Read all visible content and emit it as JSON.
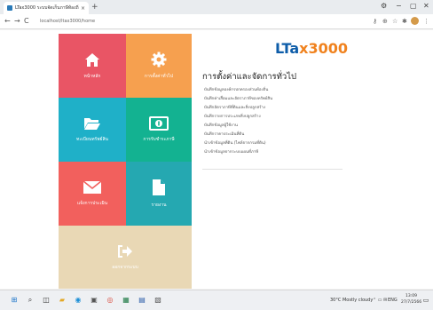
{
  "browser": {
    "tab_title": "LTax3000 ระบบจัดเก็บภาษีท้องถิ่น",
    "tab_close": "×",
    "new_tab": "+",
    "url": "localhost/ltax3000/home",
    "back": "←",
    "forward": "→",
    "reload": "C",
    "home": "⌂"
  },
  "window_controls": {
    "settings": "⚙",
    "minimize": "−",
    "maximize": "▢",
    "close": "✕"
  },
  "tiles": [
    {
      "id": "home",
      "label": "หน้าหลัก",
      "color": "#e95565",
      "icon": "home-icon"
    },
    {
      "id": "settings",
      "label": "การตั้งค่าทั่วไป",
      "color": "#f6a04f",
      "icon": "gear-icon"
    },
    {
      "id": "register",
      "label": "ทะเบียนทรัพย์สิน",
      "color": "#1fb0c8",
      "icon": "folder-icon"
    },
    {
      "id": "payment",
      "label": "การรับชำระภาษี",
      "color": "#13b291",
      "icon": "money-icon"
    },
    {
      "id": "notice",
      "label": "แจ้งการประเมิน",
      "color": "#f2605d",
      "icon": "envelope-icon"
    },
    {
      "id": "report",
      "label": "รายงาน",
      "color": "#25a8b1",
      "icon": "document-icon"
    },
    {
      "id": "logout",
      "label": "ออกจากระบบ",
      "color": "#e9d8b5",
      "icon": "logout-icon"
    }
  ],
  "logo": {
    "part1": "LTa",
    "part2": "x3000"
  },
  "content": {
    "heading": "การตั้งค่าและจัดการทั่วไป",
    "items": [
      "บันทึกข้อมูลองค์กรปกครองส่วนท้องถิ่น",
      "บันทึกค่าเสื่อมและอัตราภาษีของทรัพย์สิน",
      "บันทึกอัตราภาษีที่ดินและสิ่งปลูกสร้าง",
      "บันทึกรายการประเภทสิ่งปลูกสร้าง",
      "บันทึกข้อมูลผู้ใช้งาน",
      "บันทึกราคาประเมินที่ดิน",
      "นำเข้าข้อมูลที่ดิน (ไฟล์จากกรมที่ดิน)",
      "นำเข้าข้อมูลจากระบบแผนที่ภาษี"
    ]
  },
  "taskbar": {
    "weather": "30°C Mostly cloudy",
    "tray_icons": "⌃ ▭ ✉",
    "language": "ENG",
    "time": "13:09",
    "date": "27/7/2566",
    "apps": [
      "windows-icon",
      "search-icon",
      "task-view-icon",
      "file-explorer-icon",
      "edge-icon",
      "store-icon",
      "chrome-icon",
      "excel-icon",
      "word-icon",
      "app-icon"
    ]
  }
}
